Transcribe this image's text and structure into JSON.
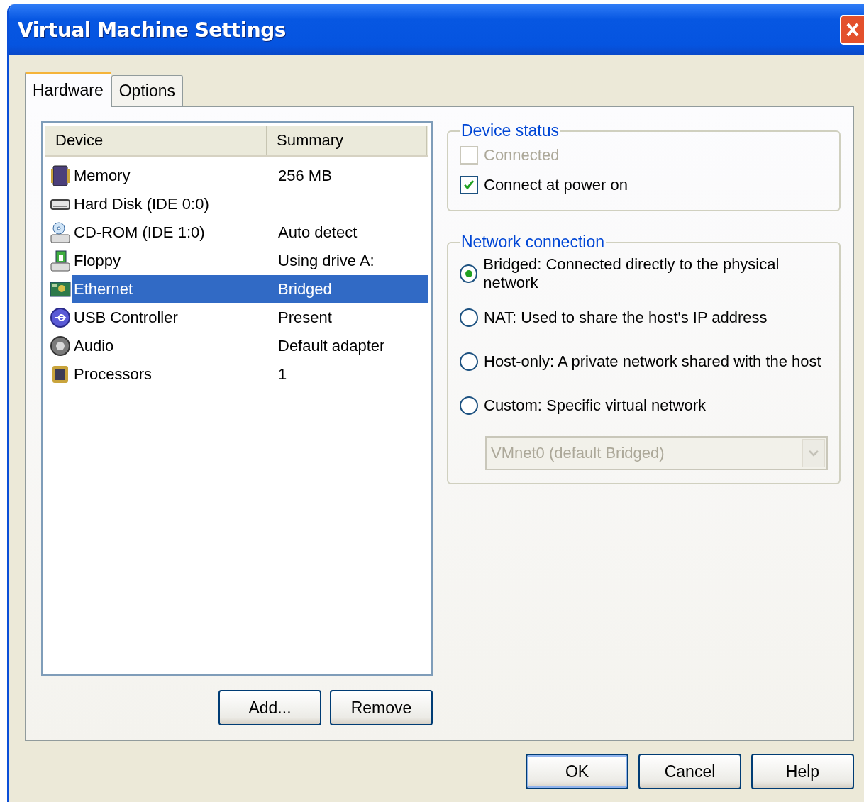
{
  "window": {
    "title": "Virtual Machine Settings"
  },
  "tabs": [
    {
      "label": "Hardware",
      "selected": true
    },
    {
      "label": "Options",
      "selected": false
    }
  ],
  "devices": {
    "columns": [
      "Device",
      "Summary"
    ],
    "rows": [
      {
        "device": "Memory",
        "summary": "256 MB",
        "selected": false
      },
      {
        "device": "Hard Disk (IDE 0:0)",
        "selected": false
      },
      {
        "device": "CD-ROM (IDE 1:0)",
        "summary": "Auto detect",
        "selected": false
      },
      {
        "device": "Floppy",
        "summary": "Using drive A:",
        "selected": false
      },
      {
        "device": "Ethernet",
        "summary": "Bridged",
        "selected": true
      },
      {
        "device": "USB Controller",
        "summary": "Present",
        "selected": false
      },
      {
        "device": "Audio",
        "summary": "Default adapter",
        "selected": false
      },
      {
        "device": "Processors",
        "summary": "1",
        "selected": false
      }
    ]
  },
  "device_buttons": [
    "Add...",
    "Remove"
  ],
  "device_status": {
    "title": "Device status",
    "options": [
      {
        "label": "Connected",
        "checked": false,
        "disabled": true
      },
      {
        "label": "Connect at power on",
        "checked": true,
        "disabled": false
      }
    ]
  },
  "network_connection": {
    "title": "Network connection",
    "options": [
      {
        "label": "Bridged: Connected directly to the physical network",
        "selected": true
      },
      {
        "label": "NAT: Used to share the host's IP address",
        "selected": false
      },
      {
        "label": "Host-only: A private network shared with the host",
        "selected": false
      },
      {
        "label": "Custom: Specific virtual network",
        "selected": false
      }
    ],
    "dropdown": {
      "value": "VMnet0 (default Bridged)",
      "disabled": true
    }
  },
  "dialog_buttons": [
    "OK",
    "Cancel",
    "Help"
  ]
}
